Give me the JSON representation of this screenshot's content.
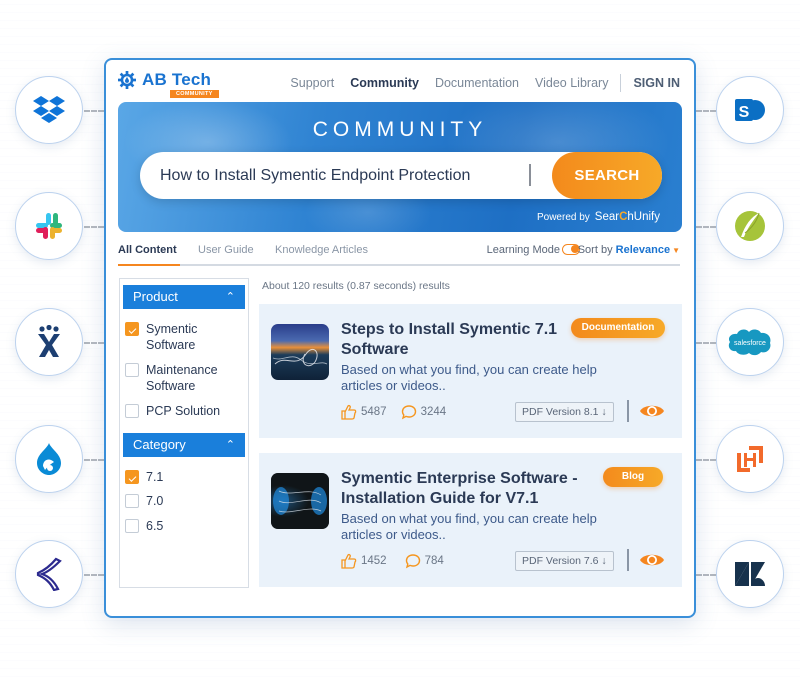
{
  "integrations": {
    "left": [
      {
        "name": "Dropbox",
        "icon": "dropbox-icon"
      },
      {
        "name": "Slack",
        "icon": "slack-icon"
      },
      {
        "name": "Jira",
        "icon": "jira-icon"
      },
      {
        "name": "Drupal",
        "icon": "drupal-icon"
      },
      {
        "name": "Khoros",
        "icon": "khoros-icon"
      }
    ],
    "right": [
      {
        "name": "SharePoint",
        "icon": "sharepoint-icon"
      },
      {
        "name": "Quill",
        "icon": "quill-icon"
      },
      {
        "name": "Salesforce",
        "icon": "salesforce-icon",
        "label": "salesforce"
      },
      {
        "name": "Higher Logic",
        "icon": "higher-logic-icon"
      },
      {
        "name": "Zendesk",
        "icon": "zendesk-icon"
      }
    ]
  },
  "header": {
    "logo_text": "AB Tech",
    "logo_badge": "COMMUNITY",
    "nav": [
      {
        "label": "Support",
        "active": false
      },
      {
        "label": "Community",
        "active": true
      },
      {
        "label": "Documentation",
        "active": false
      },
      {
        "label": "Video Library",
        "active": false
      }
    ],
    "signin_label": "SIGN IN"
  },
  "hero": {
    "title": "COMMUNITY",
    "search_value": "How to Install Symentic Endpoint Protection",
    "search_button": "SEARCH",
    "powered_by": "Powered by",
    "brand_pre": "Sear",
    "brand_mid": "C",
    "brand_post": "hUnify"
  },
  "tabs": {
    "items": [
      "All Content",
      "User Guide",
      "Knowledge Articles"
    ],
    "active_index": 0,
    "learning_mode_label": "Learning Mode",
    "learning_mode_on": true,
    "sort_label": "Sort by",
    "sort_value": "Relevance"
  },
  "filters": [
    {
      "title": "Product",
      "options": [
        {
          "label": "Symentic Software",
          "checked": true
        },
        {
          "label": "Maintenance Software",
          "checked": false
        },
        {
          "label": "PCP Solution",
          "checked": false
        }
      ]
    },
    {
      "title": "Category",
      "options": [
        {
          "label": "7.1",
          "checked": true
        },
        {
          "label": "7.0",
          "checked": false
        },
        {
          "label": "6.5",
          "checked": false
        }
      ]
    }
  ],
  "results": {
    "summary": "About 120 results (0.87 seconds) results",
    "items": [
      {
        "title": "Steps to Install Symentic 7.1 Software",
        "description": "Based on what you find, you can create help articles or videos..",
        "badge": "Documentation",
        "likes": "5487",
        "comments": "3244",
        "pdf_label": "PDF Version 8.1 ↓"
      },
      {
        "title": "Symentic Enterprise Software - Installation Guide for V7.1",
        "description": "Based on what you find, you can create help articles or videos..",
        "badge": "Blog",
        "likes": "1452",
        "comments": "784",
        "pdf_label": "PDF Version 7.6 ↓"
      }
    ]
  },
  "colors": {
    "primary": "#1a7fdb",
    "accent": "#f5861f",
    "text": "#2b3a55"
  }
}
